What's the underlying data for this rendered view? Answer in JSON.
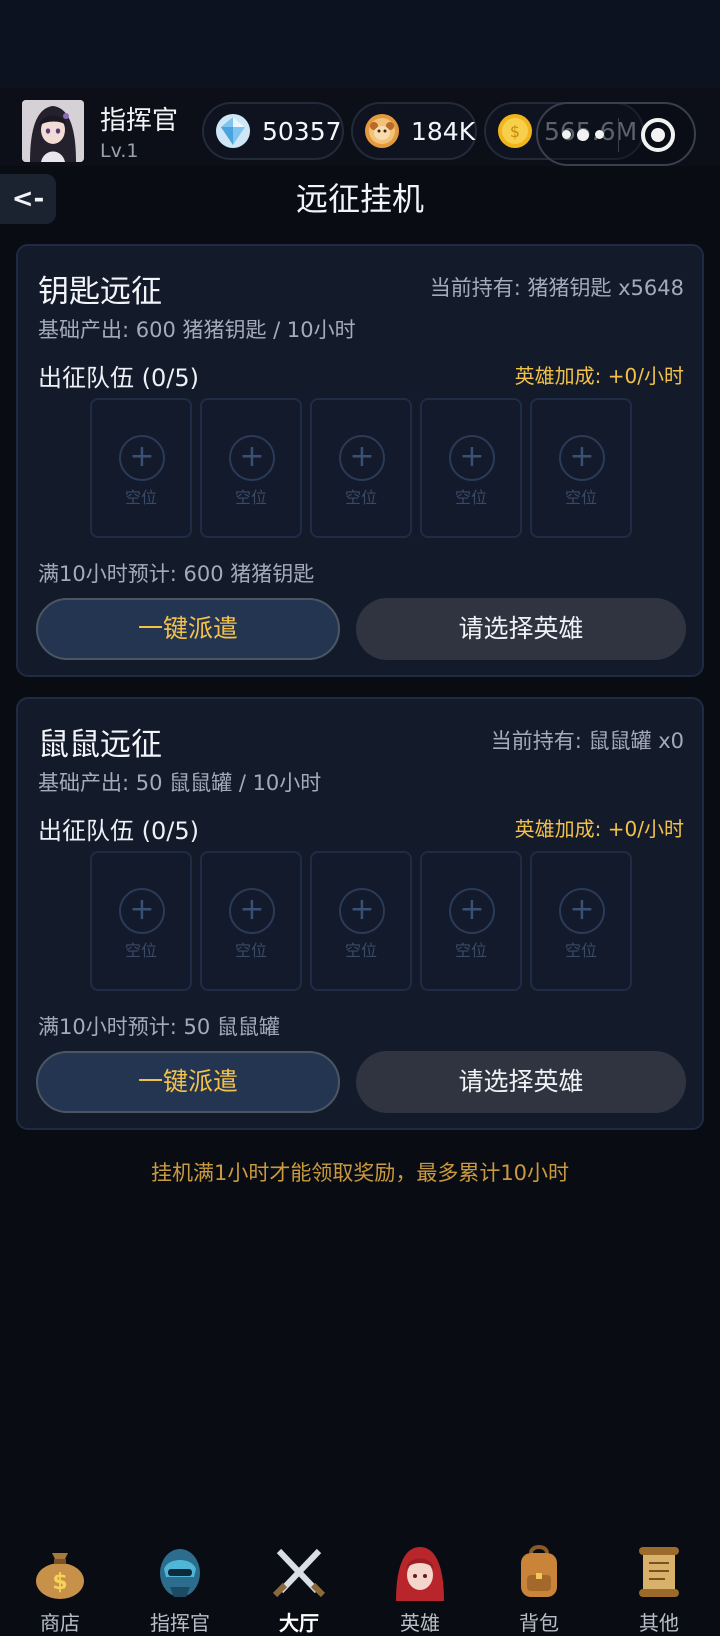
{
  "header": {
    "player_name": "指挥官",
    "player_level": "Lv.1",
    "currencies": [
      {
        "icon": "diamond-icon",
        "value": "50357"
      },
      {
        "icon": "monkey-coin-icon",
        "value": "184K"
      },
      {
        "icon": "gold-coin-icon",
        "value": "565.6M"
      }
    ]
  },
  "page": {
    "back_label": "<-",
    "title": "远征挂机"
  },
  "expeditions": [
    {
      "title": "钥匙远征",
      "holding": "当前持有: 猪猪钥匙 x5648",
      "base_output": "基础产出: 600 猪猪钥匙 / 10小时",
      "team_label": "出征队伍 (0/5)",
      "hero_bonus": "英雄加成: +0/小时",
      "slots": [
        {
          "label": "空位"
        },
        {
          "label": "空位"
        },
        {
          "label": "空位"
        },
        {
          "label": "空位"
        },
        {
          "label": "空位"
        }
      ],
      "estimate": "满10小时预计: 600 猪猪钥匙",
      "dispatch_label": "一键派遣",
      "select_label": "请选择英雄"
    },
    {
      "title": "鼠鼠远征",
      "holding": "当前持有: 鼠鼠罐 x0",
      "base_output": "基础产出: 50 鼠鼠罐 / 10小时",
      "team_label": "出征队伍 (0/5)",
      "hero_bonus": "英雄加成: +0/小时",
      "slots": [
        {
          "label": "空位"
        },
        {
          "label": "空位"
        },
        {
          "label": "空位"
        },
        {
          "label": "空位"
        },
        {
          "label": "空位"
        }
      ],
      "estimate": "满10小时预计: 50 鼠鼠罐",
      "dispatch_label": "一键派遣",
      "select_label": "请选择英雄"
    }
  ],
  "tip": "挂机满1小时才能领取奖励，最多累计10小时",
  "tabs": [
    {
      "label": "商店",
      "icon": "money-bag-icon"
    },
    {
      "label": "指挥官",
      "icon": "commander-helmet-icon"
    },
    {
      "label": "大厅",
      "icon": "crossed-swords-icon",
      "active": true
    },
    {
      "label": "英雄",
      "icon": "hero-portrait-icon"
    },
    {
      "label": "背包",
      "icon": "backpack-icon"
    },
    {
      "label": "其他",
      "icon": "scroll-icon"
    }
  ],
  "colors": {
    "accent_gold": "#f2c14a",
    "tip_orange": "#c99a3e",
    "card_bg": "#131a2a",
    "dispatch_bg": "#243552"
  }
}
